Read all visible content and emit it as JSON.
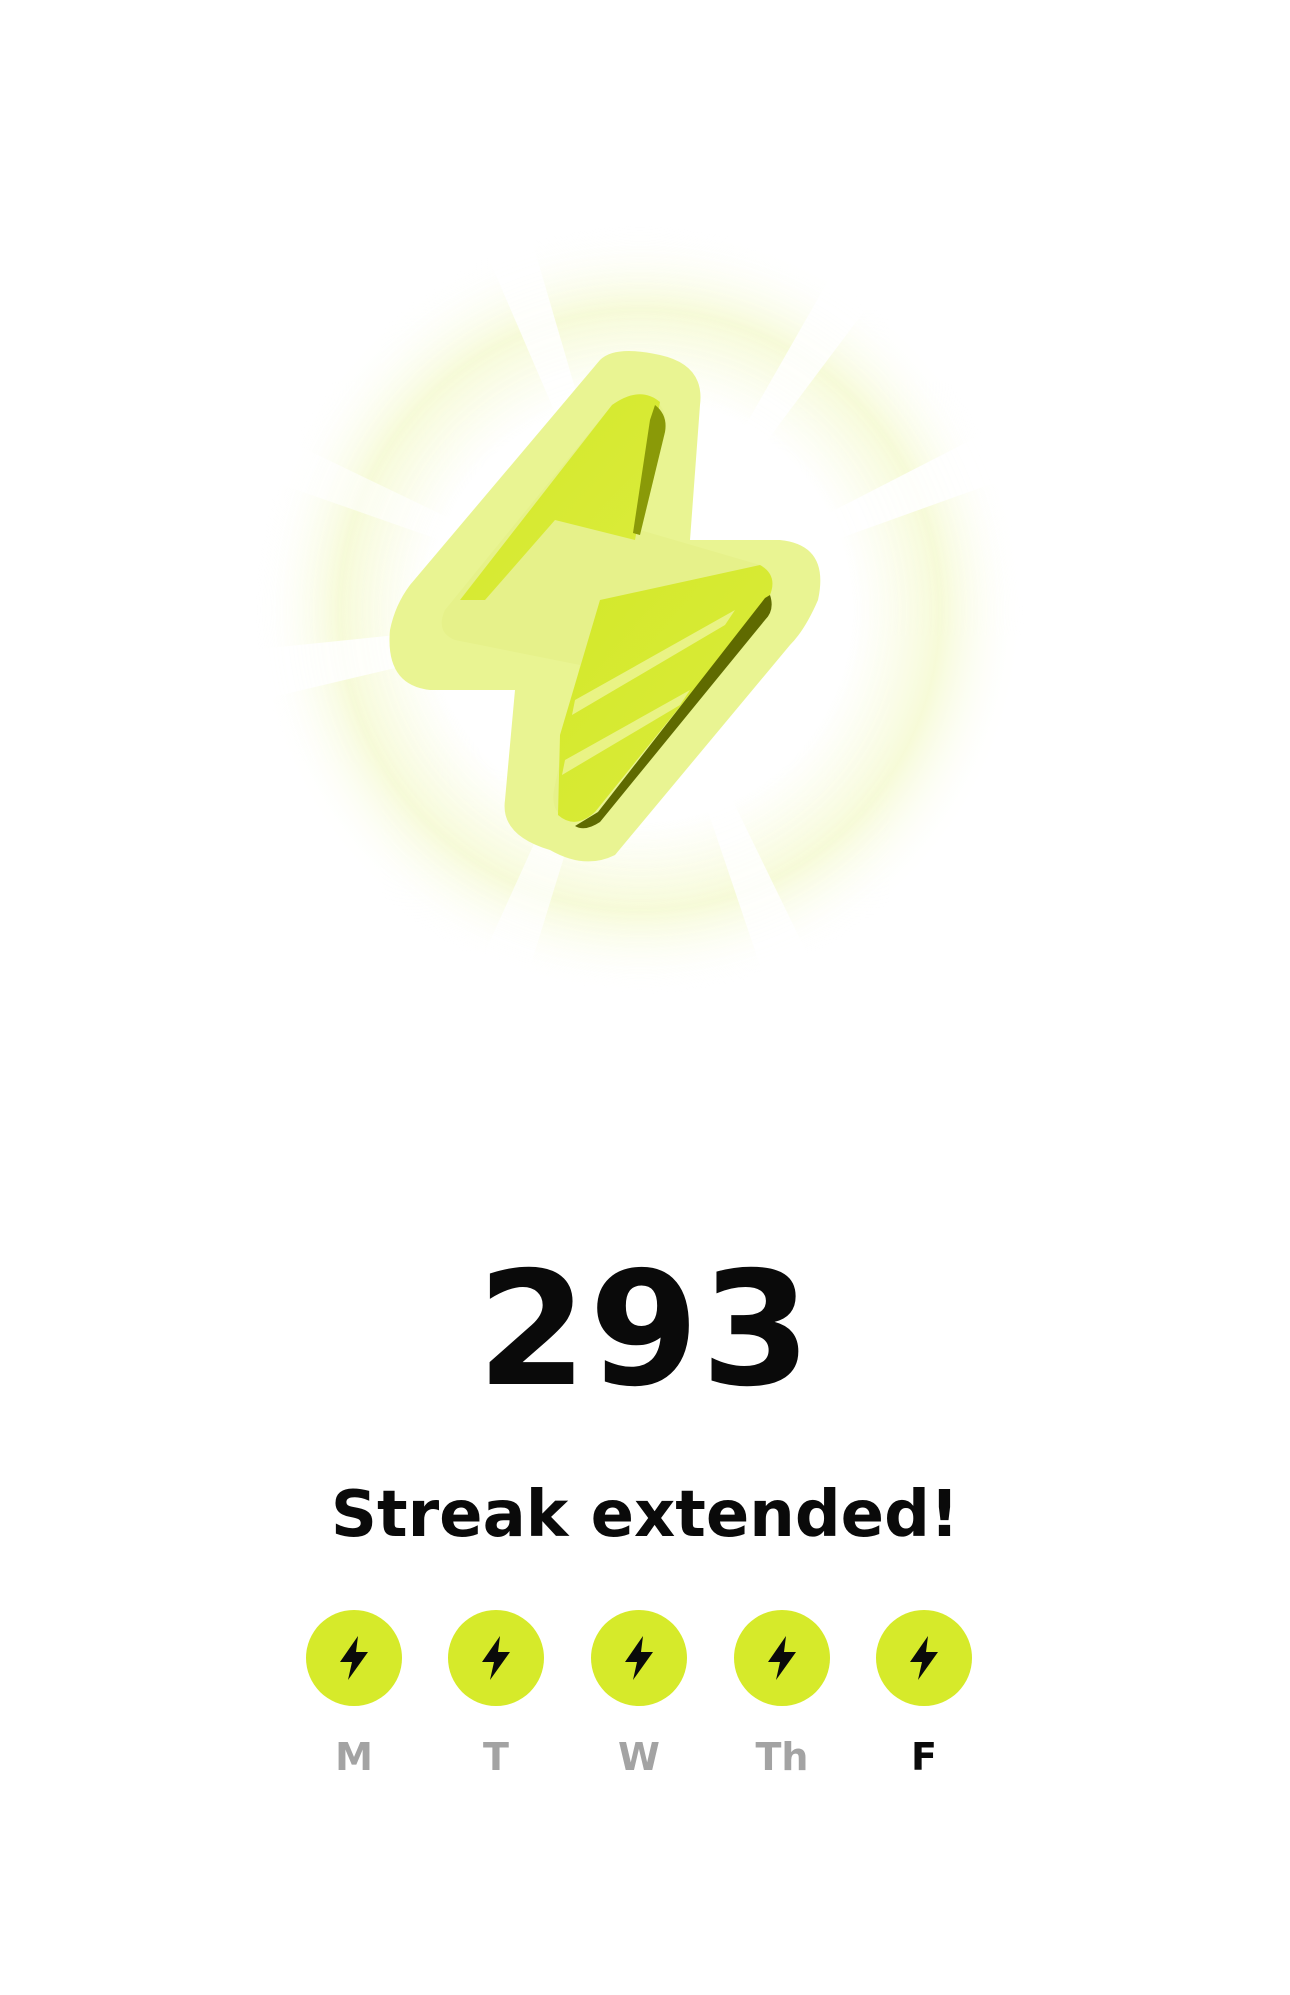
{
  "streak": {
    "count": "293",
    "message": "Streak extended!"
  },
  "week": {
    "days": [
      {
        "label": "M",
        "completed": true,
        "current": false,
        "icon": "bolt-icon"
      },
      {
        "label": "T",
        "completed": true,
        "current": false,
        "icon": "bolt-icon"
      },
      {
        "label": "W",
        "completed": true,
        "current": false,
        "icon": "bolt-icon"
      },
      {
        "label": "Th",
        "completed": true,
        "current": false,
        "icon": "bolt-icon"
      },
      {
        "label": "F",
        "completed": true,
        "current": true,
        "icon": "bolt-icon"
      }
    ]
  },
  "hero": {
    "icon": "lightning-bolt-icon"
  },
  "colors": {
    "accent": "#d6ea2a",
    "accent_light": "#e8f38a",
    "accent_dark": "#7a8a00",
    "text_primary": "#0a0a0a",
    "text_muted": "#a3a3a3"
  }
}
